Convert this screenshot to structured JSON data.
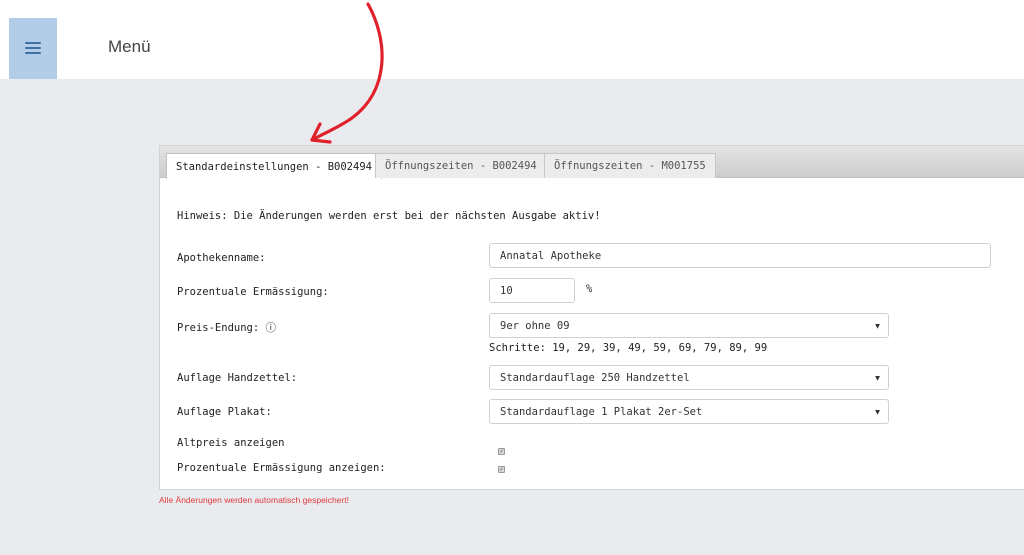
{
  "header": {
    "menu_label": "Menü",
    "menu_icon": "hamburger-icon"
  },
  "annotation": {
    "arrow_color": "#e0202a"
  },
  "tabs": [
    {
      "label": "Standardeinstellungen - B002494",
      "active": true
    },
    {
      "label": "Öffnungszeiten - B002494",
      "active": false
    },
    {
      "label": "Öffnungszeiten - M001755",
      "active": false
    }
  ],
  "form": {
    "hint": "Hinweis: Die Änderungen werden erst bei der nächsten Ausgabe aktiv!",
    "pharmacy_name": {
      "label": "Apothekenname:",
      "value": "Annatal Apotheke"
    },
    "discount": {
      "label": "Prozentuale Ermässigung:",
      "value": "10",
      "unit": "%"
    },
    "price_ending": {
      "label": "Preis-Endung: ⓘ",
      "value": "9er ohne 09",
      "steps": "Schritte: 19, 29, 39, 49, 59, 69, 79, 89, 99"
    },
    "flyer_run": {
      "label": "Auflage Handzettel:",
      "value": "Standardauflage 250 Handzettel"
    },
    "poster_run": {
      "label": "Auflage Plakat:",
      "value": "Standardauflage 1 Plakat 2er-Set"
    },
    "show_old_price": {
      "label": "Altpreis anzeigen",
      "checked": true
    },
    "show_discount_pct": {
      "label": "Prozentuale Ermässigung anzeigen:",
      "checked": true
    }
  },
  "footer_note": "Alle Änderungen werden automatisch gespeichert!",
  "colors": {
    "accent": "#b3cde8",
    "warning": "#e03a3a"
  }
}
